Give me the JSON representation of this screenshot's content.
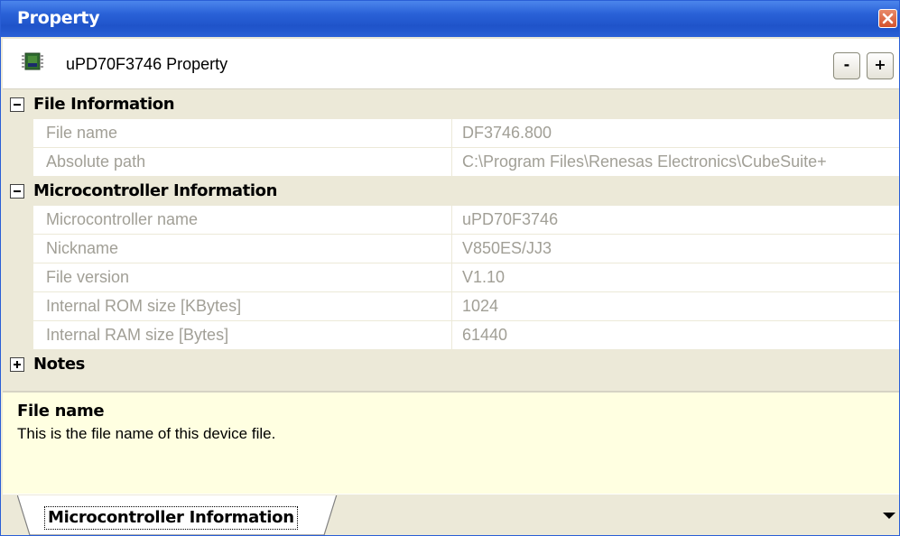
{
  "window": {
    "title": "Property"
  },
  "header": {
    "title": "uPD70F3746 Property",
    "collapse_label": "-",
    "expand_label": "+"
  },
  "grid": {
    "categories": [
      {
        "label": "File Information",
        "expanded": true,
        "properties": [
          {
            "name": "File name",
            "value": "DF3746.800"
          },
          {
            "name": "Absolute path",
            "value": "C:\\Program Files\\Renesas Electronics\\CubeSuite+"
          }
        ]
      },
      {
        "label": "Microcontroller Information",
        "expanded": true,
        "properties": [
          {
            "name": "Microcontroller name",
            "value": "uPD70F3746"
          },
          {
            "name": "Nickname",
            "value": "V850ES/JJ3"
          },
          {
            "name": "File version",
            "value": "V1.10"
          },
          {
            "name": "Internal ROM size [KBytes]",
            "value": "1024"
          },
          {
            "name": "Internal RAM size [Bytes]",
            "value": "61440"
          }
        ]
      },
      {
        "label": "Notes",
        "expanded": false,
        "properties": []
      }
    ]
  },
  "description": {
    "title": "File name",
    "text": "This is the file name of this device file."
  },
  "tabs": [
    {
      "label": "Microcontroller Information",
      "active": true
    }
  ],
  "icons": {
    "close": "close-icon",
    "header": "microcontroller-chip-icon",
    "tab_menu": "dropdown-arrow-icon"
  },
  "colors": {
    "titlebar": "#2a62d8",
    "category_background": "#ece9d8",
    "readonly_text": "#a19f96",
    "description_background": "#ffffe1"
  }
}
